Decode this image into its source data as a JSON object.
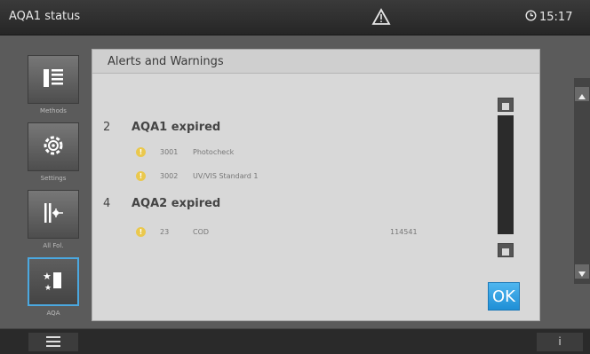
{
  "header": {
    "title": "AQA1 status",
    "time": "15:17"
  },
  "nav": [
    {
      "label": "Methods"
    },
    {
      "label": "Settings"
    },
    {
      "label": "All Fol."
    },
    {
      "label": "AQA"
    }
  ],
  "dialog": {
    "title": "Alerts and Warnings",
    "ok_label": "OK",
    "groups": [
      {
        "number": "2",
        "title": "AQA1 expired",
        "rows": [
          {
            "code": "3001",
            "name": "Photocheck",
            "extra": ""
          },
          {
            "code": "3002",
            "name": "UV/VIS Standard 1",
            "extra": ""
          }
        ]
      },
      {
        "number": "4",
        "title": "AQA2 expired",
        "rows": [
          {
            "code": "23",
            "name": "COD",
            "extra": "114541"
          }
        ]
      }
    ]
  },
  "footer": {
    "info_label": "i"
  },
  "colors": {
    "accent": "#2a9be3",
    "warning": "#eac84d"
  }
}
